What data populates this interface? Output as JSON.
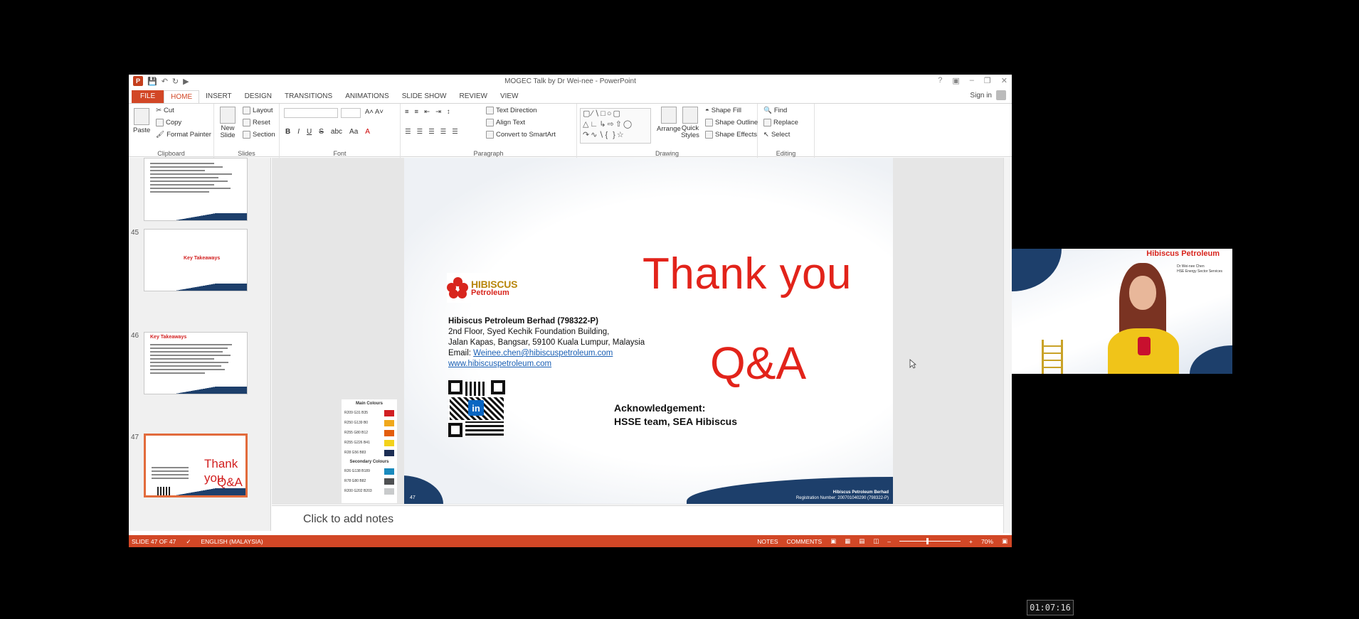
{
  "window": {
    "title": "MOGEC Talk by Dr Wei-nee - PowerPoint",
    "sign_in": "Sign in"
  },
  "tabs": [
    "FILE",
    "HOME",
    "INSERT",
    "DESIGN",
    "TRANSITIONS",
    "ANIMATIONS",
    "SLIDE SHOW",
    "REVIEW",
    "VIEW"
  ],
  "active_tab": "HOME",
  "ribbon": {
    "clipboard": {
      "paste": "Paste",
      "cut": "Cut",
      "copy": "Copy",
      "format_painter": "Format Painter",
      "label": "Clipboard"
    },
    "slides": {
      "new_slide": "New Slide",
      "layout": "Layout",
      "reset": "Reset",
      "section": "Section",
      "label": "Slides"
    },
    "font": {
      "bold": "B",
      "italic": "I",
      "underline": "U",
      "strike": "S",
      "label": "Font"
    },
    "paragraph": {
      "text_direction": "Text Direction",
      "align_text": "Align Text",
      "convert": "Convert to SmartArt",
      "label": "Paragraph"
    },
    "drawing": {
      "arrange": "Arrange",
      "quick_styles": "Quick Styles",
      "shape_fill": "Shape Fill",
      "shape_outline": "Shape Outline",
      "shape_effects": "Shape Effects",
      "label": "Drawing"
    },
    "editing": {
      "find": "Find",
      "replace": "Replace",
      "select": "Select",
      "label": "Editing"
    }
  },
  "thumbnails": [
    {
      "num": "45",
      "title": "Key Takeaways"
    },
    {
      "num": "46",
      "title": "Key Takeaways"
    },
    {
      "num": "47",
      "title": "Thank you",
      "subtitle": "Q&A"
    }
  ],
  "slide": {
    "thank_you": "Thank you",
    "qa": "Q&A",
    "logo_h": "HIBISCUS",
    "logo_p": "Petroleum",
    "company": "Hibiscus Petroleum Berhad (798322-P)",
    "addr1": "2nd Floor, Syed Kechik Foundation Building,",
    "addr2": "Jalan Kapas, Bangsar, 59100 Kuala Lumpur, Malaysia",
    "email_label": "Email: ",
    "email": "Weinee.chen@hibiscuspetroleum.com",
    "website": "www.hibiscuspetroleum.com",
    "ack_title": "Acknowledgement:",
    "ack_body": "HSSE team, SEA Hibiscus",
    "footer1": "Hibiscus Petroleum Berhad",
    "footer2": "Registration Number: 200701040290 (798322-P)",
    "num": "47"
  },
  "palette": {
    "main_title": "Main Colours",
    "main": [
      {
        "label": "R209 G31 B35",
        "color": "#d11f23"
      },
      {
        "label": "R250 G139 B0",
        "color": "#f0a81c"
      },
      {
        "label": "R255 G80 B12",
        "color": "#e35d0c"
      },
      {
        "label": "R255 G226 B41",
        "color": "#f3d21c"
      },
      {
        "label": "R28 G56 B83",
        "color": "#1c2e53"
      }
    ],
    "secondary_title": "Secondary Colours",
    "secondary": [
      {
        "label": "R26 G138 B189",
        "color": "#1a8abd"
      },
      {
        "label": "R78 G80 B82",
        "color": "#4e5052"
      },
      {
        "label": "R200 G202 B203",
        "color": "#c8cacb"
      }
    ]
  },
  "notes_placeholder": "Click to add notes",
  "status": {
    "slide": "SLIDE 47 OF 47",
    "language": "ENGLISH (MALAYSIA)",
    "notes": "NOTES",
    "comments": "COMMENTS",
    "zoom": "70%"
  },
  "webcam": {
    "logo": "Hibiscus Petroleum",
    "name": "Dr Wei-nee Chen",
    "role": "HSE Energy Sector Services"
  },
  "timer": "01:07:16"
}
